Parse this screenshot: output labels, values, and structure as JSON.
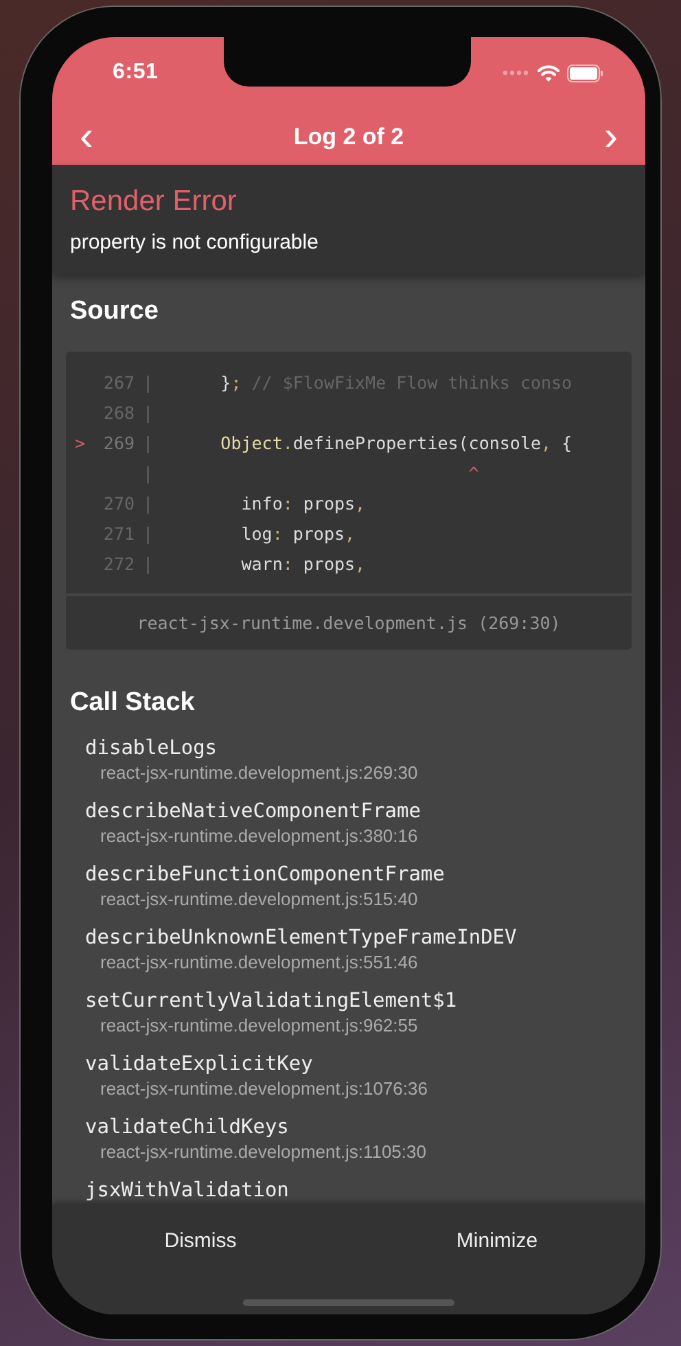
{
  "status_bar": {
    "time": "6:51"
  },
  "nav": {
    "prev": "‹",
    "title": "Log 2 of 2",
    "next": "›"
  },
  "error": {
    "title": "Render Error",
    "message": "property is not configurable"
  },
  "source": {
    "heading": "Source",
    "lines": [
      {
        "number": "267",
        "separator": "|",
        "current": false,
        "tokens": [
          {
            "text": "      }",
            "kind": "plain"
          },
          {
            "text": ";",
            "kind": "punct"
          },
          {
            "text": " // $FlowFixMe Flow thinks conso",
            "kind": "comment"
          }
        ]
      },
      {
        "number": "268",
        "separator": "|",
        "current": false
      },
      {
        "number": "269",
        "marker": ">",
        "separator": "|",
        "current": true,
        "tokens": [
          {
            "text": "      Object",
            "kind": "keyword"
          },
          {
            "text": ".",
            "kind": "punct"
          },
          {
            "text": "defineProperties(console",
            "kind": "plain"
          },
          {
            "text": ",",
            "kind": "punct"
          },
          {
            "text": " {",
            "kind": "plain"
          }
        ]
      },
      {
        "separator": "|",
        "current": false,
        "tokens": [
          {
            "text": "                              ^",
            "kind": "caret"
          }
        ]
      },
      {
        "number": "270",
        "separator": "|",
        "current": false,
        "tokens": [
          {
            "text": "        info",
            "kind": "plain"
          },
          {
            "text": ":",
            "kind": "punct"
          },
          {
            "text": " props",
            "kind": "plain"
          },
          {
            "text": ",",
            "kind": "punct"
          }
        ]
      },
      {
        "number": "271",
        "separator": "|",
        "current": false,
        "tokens": [
          {
            "text": "        log",
            "kind": "plain"
          },
          {
            "text": ":",
            "kind": "punct"
          },
          {
            "text": " props",
            "kind": "plain"
          },
          {
            "text": ",",
            "kind": "punct"
          }
        ]
      },
      {
        "number": "272",
        "separator": "|",
        "current": false,
        "tokens": [
          {
            "text": "        warn",
            "kind": "plain"
          },
          {
            "text": ":",
            "kind": "punct"
          },
          {
            "text": " props",
            "kind": "plain"
          },
          {
            "text": ",",
            "kind": "punct"
          }
        ]
      }
    ],
    "file": "react-jsx-runtime.development.js (269:30)"
  },
  "call_stack": {
    "heading": "Call Stack",
    "frames": [
      {
        "name": "disableLogs",
        "location": "react-jsx-runtime.development.js:269:30"
      },
      {
        "name": "describeNativeComponentFrame",
        "location": "react-jsx-runtime.development.js:380:16"
      },
      {
        "name": "describeFunctionComponentFrame",
        "location": "react-jsx-runtime.development.js:515:40"
      },
      {
        "name": "describeUnknownElementTypeFrameInDEV",
        "location": "react-jsx-runtime.development.js:551:46"
      },
      {
        "name": "setCurrentlyValidatingElement$1",
        "location": "react-jsx-runtime.development.js:962:55"
      },
      {
        "name": "validateExplicitKey",
        "location": "react-jsx-runtime.development.js:1076:36"
      },
      {
        "name": "validateChildKeys",
        "location": "react-jsx-runtime.development.js:1105:30"
      },
      {
        "name": "jsxWithValidation"
      }
    ]
  },
  "footer": {
    "buttons": [
      "Dismiss",
      "Minimize"
    ]
  }
}
